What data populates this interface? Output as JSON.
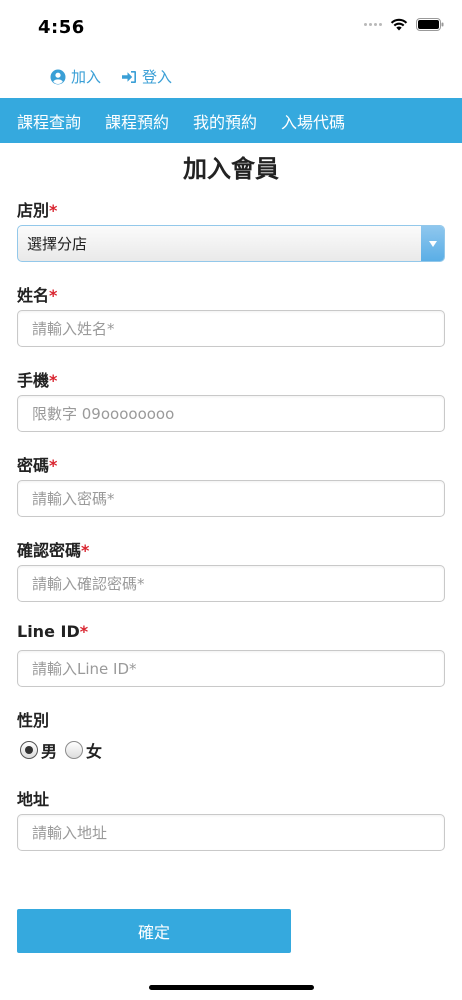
{
  "status_bar": {
    "time": "4:56",
    "icons": [
      "cellular-signal-icon",
      "wifi-icon",
      "battery-icon"
    ]
  },
  "top_links": {
    "join_label": "加入",
    "login_label": "登入",
    "join_icon": "user-circle-icon",
    "login_icon": "sign-in-icon"
  },
  "nav": {
    "items": [
      {
        "label": "課程查詢"
      },
      {
        "label": "課程預約"
      },
      {
        "label": "我的預約"
      },
      {
        "label": "入場代碼"
      }
    ]
  },
  "page": {
    "title": "加入會員"
  },
  "form": {
    "store": {
      "label": "店別",
      "required_mark": "*",
      "selected": "選擇分店"
    },
    "name": {
      "label": "姓名",
      "required_mark": "*",
      "placeholder": "請輸入姓名*",
      "value": ""
    },
    "phone": {
      "label": "手機",
      "required_mark": "*",
      "placeholder": "限數字 09oooooooo",
      "value": ""
    },
    "password": {
      "label": "密碼",
      "required_mark": "*",
      "placeholder": "請輸入密碼*",
      "value": ""
    },
    "confirm_password": {
      "label": "確認密碼",
      "required_mark": "*",
      "placeholder": "請輸入確認密碼*",
      "value": ""
    },
    "line_id": {
      "label": "Line ID",
      "required_mark": "*",
      "placeholder": "請輸入Line ID*",
      "value": ""
    },
    "gender": {
      "label": "性別",
      "options": [
        {
          "label": "男",
          "checked": true
        },
        {
          "label": "女",
          "checked": false
        }
      ]
    },
    "address": {
      "label": "地址",
      "placeholder": "請輸入地址",
      "value": ""
    },
    "submit_label": "確定"
  },
  "colors": {
    "accent": "#35a9de",
    "link": "#3a9fd6",
    "required": "#d9232e"
  }
}
